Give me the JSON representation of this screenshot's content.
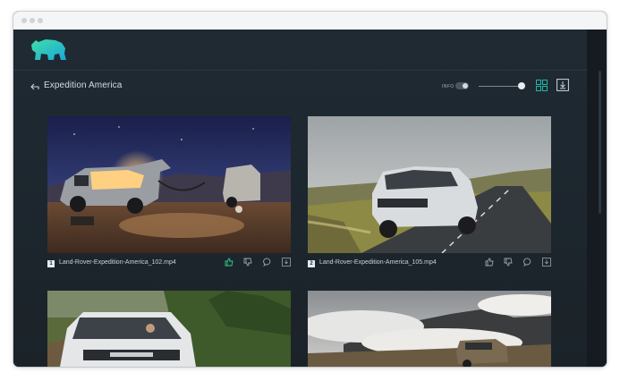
{
  "header": {
    "logo_icon": "bear-logo-icon",
    "brand_color": "#1fc7c0"
  },
  "toolbar": {
    "back_icon": "back-arrow-icon",
    "album_title": "Expedition America",
    "info_label": "INFO",
    "info_toggle_on": true,
    "size_slider_value": 1.0,
    "grid_view_icon": "grid-view-icon",
    "download_icon": "download-icon",
    "accent_color": "#1fb8a6"
  },
  "assets": [
    {
      "index": "1",
      "file_name": "Land-Rover-Expedition-America_102.mp4",
      "liked": true
    },
    {
      "index": "2",
      "file_name": "Land-Rover-Expedition-America_105.mp4",
      "liked": false
    },
    {
      "index": "",
      "file_name": ""
    },
    {
      "index": "",
      "file_name": ""
    }
  ],
  "action_icons": [
    "thumbs-up-icon",
    "thumbs-down-icon",
    "comment-icon",
    "download-icon"
  ]
}
